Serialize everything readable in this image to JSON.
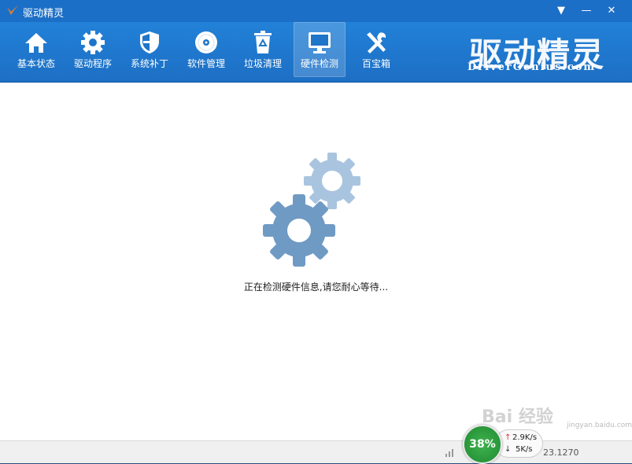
{
  "titlebar": {
    "title": "驱动精灵",
    "menu_glyph": "▼",
    "min_glyph": "—",
    "close_glyph": "✕"
  },
  "toolbar": {
    "items": [
      {
        "label": "基本状态",
        "icon": "home-icon"
      },
      {
        "label": "驱动程序",
        "icon": "gear-icon"
      },
      {
        "label": "系统补丁",
        "icon": "shield-icon"
      },
      {
        "label": "软件管理",
        "icon": "disc-icon"
      },
      {
        "label": "垃圾清理",
        "icon": "recycle-bin-icon"
      },
      {
        "label": "硬件检测",
        "icon": "monitor-icon",
        "active": true
      },
      {
        "label": "百宝箱",
        "icon": "tools-icon"
      }
    ]
  },
  "brand": {
    "cn": "驱动精灵",
    "en": "DriverGenius.com"
  },
  "main": {
    "message": "正在检测硬件信息,请您耐心等待..."
  },
  "statusbar": {
    "version": "23.1270"
  },
  "network": {
    "percent": "38%",
    "up": "2.9K/s",
    "down": "5K/s"
  },
  "watermark": {
    "text": "Bai 经验",
    "url": "jingyan.baidu.com"
  },
  "colors": {
    "accent": "#1c6fc6",
    "gear_dark": "#6f9ac4",
    "gear_light": "#a9c4df",
    "net_green": "#2a9a3a"
  }
}
